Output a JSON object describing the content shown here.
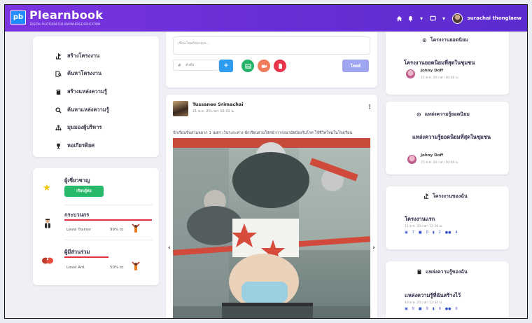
{
  "header": {
    "logo_mark": "pb",
    "brand": "Plearnbook",
    "tagline": "DIGITAL PLATFORM FOR KNOWLEDGE EDUCATION",
    "user_name": "surachai thonglaew"
  },
  "menu": {
    "items": [
      {
        "label": "สร้างโครงงาน",
        "icon": "project-create-icon"
      },
      {
        "label": "ค้นหาโครงงาน",
        "icon": "project-search-icon"
      },
      {
        "label": "สร้างแหล่งความรู้",
        "icon": "book-create-icon"
      },
      {
        "label": "ค้นหาแหล่งความรู้",
        "icon": "search-icon"
      },
      {
        "label": "มุมมองผู้บริหาร",
        "icon": "org-chart-icon"
      },
      {
        "label": "หอเกียรติยศ",
        "icon": "trophy-icon"
      }
    ]
  },
  "ranking": {
    "expert": {
      "title": "ผู้เชี่ยวชาญ",
      "button": "เรียนรู้ต่อ"
    },
    "trainer": {
      "title": "กระบวนกร",
      "level": "Level Trainer",
      "percent_text": "99% to",
      "progress": 0.99
    },
    "participant": {
      "title": "ผู้มีส่วนร่วม",
      "level": "Level Ant",
      "percent_text": "50% to",
      "progress": 0.5
    }
  },
  "composer": {
    "placeholder": "เขียนโพสต์ของคุณ...",
    "field_label": "หัวข้อ",
    "send_label": "โพสต์"
  },
  "post": {
    "author": "Tussanee Srimachai",
    "time": "21 ต.ค. 20 เวลา 10:31 น.",
    "text": "นักเรียนจีนสวมหมวก 1 เมตร เว้นระยะห่าง นักเรียนสวมใส่หน้ากากอนามัยป้องกันโรค ใช้ชีวิตใหม่ในโรงเรียน"
  },
  "right": {
    "popular_projects": {
      "heading": "โครงงานยอดนิยม",
      "item_title": "โครงงานยอดนิยมที่สุดในชุมชน",
      "author": "Johny Doff",
      "date": "15 ต.ค. 20 เวลา 10:08 น."
    },
    "popular_sources": {
      "heading": "แหล่งความรู้ยอดนิยม",
      "item_title": "แหล่งความรู้ยอดนิยมที่สุดในชุมชน",
      "author": "Johny Doff",
      "date": "15 ต.ค. 20 เวลา 10:08 น."
    },
    "my_projects": {
      "heading": "โครงงานของฉัน",
      "item_title": "โครงงานแรก",
      "date": "11 ต.ค. 20 เวลา 12:30 น.",
      "stats": [
        "7",
        "0",
        "2",
        "4"
      ]
    },
    "my_sources": {
      "heading": "แหล่งความรู้ของฉัน",
      "item_title": "แหล่งความรู้ที่ฉันสร้างไว้",
      "date": "16 ต.ค. 20 เวลา 12:30 น.",
      "stats": [
        "0",
        "0",
        "0",
        "0"
      ]
    }
  },
  "colors": {
    "header_start": "#7c34e0",
    "header_end": "#5b2ccf",
    "follow_green": "#26b96a",
    "progress_red": "#e0313c",
    "send_blue": "#9fa5f0"
  }
}
